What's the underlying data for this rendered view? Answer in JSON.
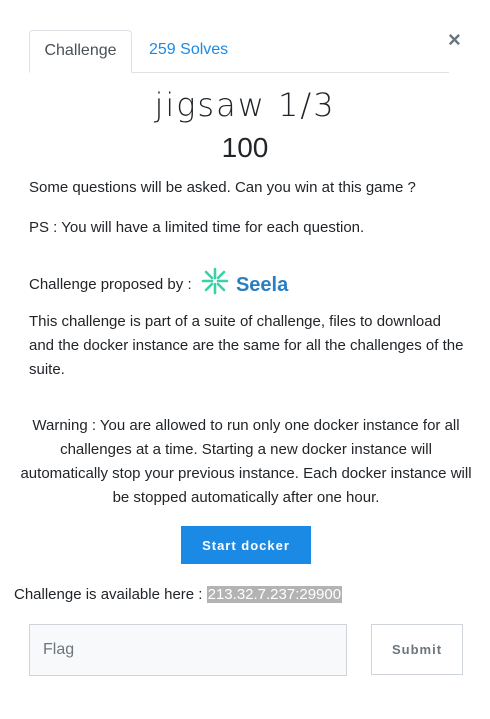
{
  "tabs": {
    "challenge_label": "Challenge",
    "solves_label": "259 Solves"
  },
  "close_symbol": "×",
  "challenge": {
    "name": "jigsaw 1/3",
    "points": "100",
    "description_1": "Some questions will be asked. Can you win at this game ?",
    "description_2": "PS : You will have a limited time for each question.",
    "proposed_by_label": "Challenge proposed by :",
    "author_logo_text": "Seela",
    "suite_note": "This challenge is part of a suite of challenge, files to download and the docker instance are the same for all the challenges of the suite.",
    "warning": "Warning : You are allowed to run only one docker instance for all challenges at a time. Starting a new docker instance will automatically stop your previous instance. Each docker instance will be stopped automatically after one hour."
  },
  "docker": {
    "start_label": "Start docker",
    "available_label": "Challenge is available here :",
    "address": "213.32.7.237:29900"
  },
  "flag_form": {
    "placeholder": "Flag",
    "submit_label": "Submit"
  },
  "colors": {
    "accent": "#1b8ae4",
    "logo_green": "#3ad1a6",
    "logo_blue": "#2a7fc2"
  }
}
